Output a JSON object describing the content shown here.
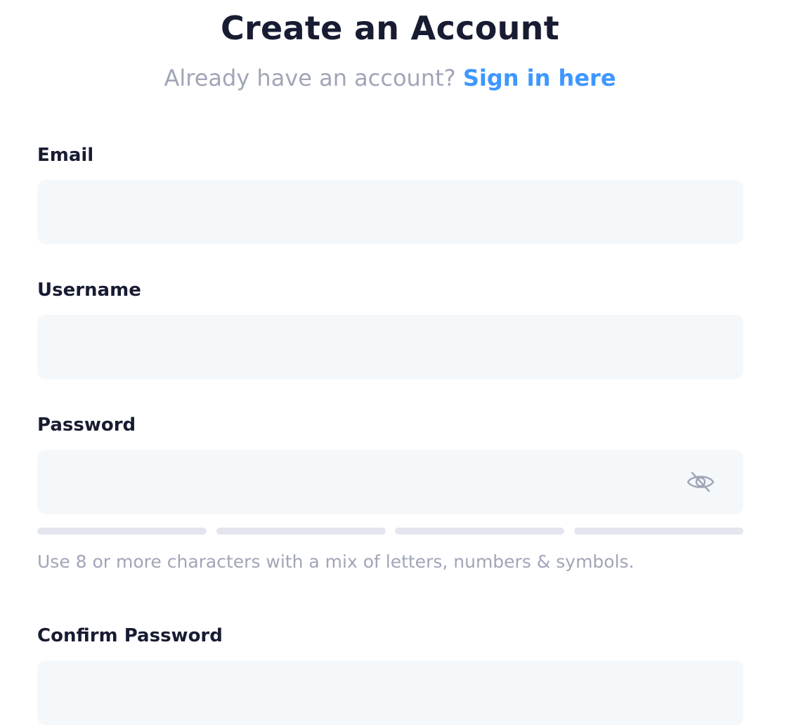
{
  "header": {
    "title": "Create an Account",
    "subtitle_text": "Already have an account?",
    "signin_link": "Sign in here"
  },
  "form": {
    "email": {
      "label": "Email",
      "value": ""
    },
    "username": {
      "label": "Username",
      "value": ""
    },
    "password": {
      "label": "Password",
      "value": "",
      "toggle_icon": "eye-off-icon",
      "strength_segments_filled": 0,
      "strength_segments_total": 4,
      "hint": "Use 8 or more characters with a mix of letters, numbers & symbols."
    },
    "confirm_password": {
      "label": "Confirm Password",
      "value": ""
    }
  },
  "colors": {
    "text_dark": "#181c32",
    "text_muted": "#a1a5b7",
    "link": "#3e97ff",
    "field_bg": "#f5f8fa",
    "meter_empty": "#e4e6ef"
  }
}
